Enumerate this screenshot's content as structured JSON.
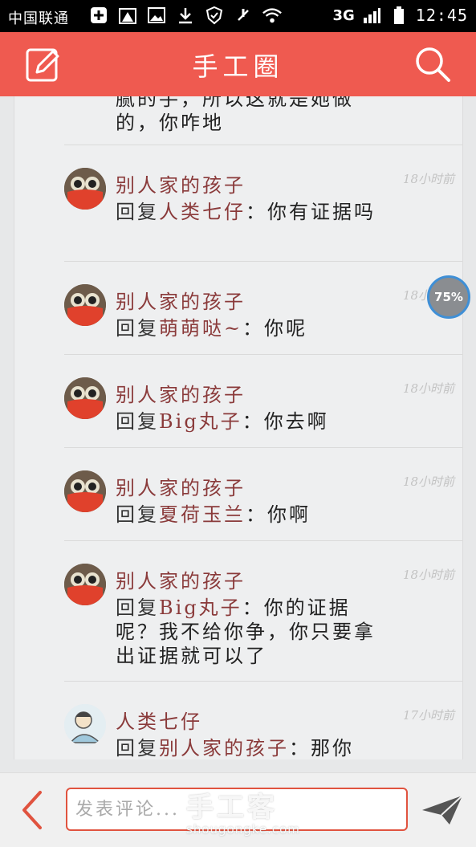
{
  "status_bar": {
    "carrier": "中国联通",
    "network": "3G",
    "time": "12:45",
    "icons": [
      "plus-icon",
      "warning-icon",
      "image-icon",
      "download-icon",
      "shield-icon",
      "mute-icon",
      "wifi-icon",
      "signal-icon",
      "battery-icon"
    ]
  },
  "header": {
    "title": "手工圈",
    "left_icon": "edit-icon",
    "right_icon": "search-icon",
    "background": "#ef5a50"
  },
  "comments": [
    {
      "partial": true,
      "text_line1": "腻的手，所以这就是她做",
      "text_line2": "的，你咋地"
    },
    {
      "author": "别人家的孩子",
      "time": "18小时前",
      "reply_label": "回复",
      "reply_target": "人类七仔",
      "separator": "：",
      "content": "你有证据吗"
    },
    {
      "author": "别人家的孩子",
      "time": "18小时前",
      "reply_label": "回复",
      "reply_target": "萌萌哒~",
      "separator": "：",
      "content": "你呢"
    },
    {
      "author": "别人家的孩子",
      "time": "18小时前",
      "reply_label": "回复",
      "reply_target": "Big丸子",
      "separator": "：",
      "content": "你去啊"
    },
    {
      "author": "别人家的孩子",
      "time": "18小时前",
      "reply_label": "回复",
      "reply_target": "夏荷玉兰",
      "separator": "：",
      "content": "你啊"
    },
    {
      "author": "别人家的孩子",
      "time": "18小时前",
      "reply_label": "回复",
      "reply_target": "Big丸子",
      "separator": "：",
      "content": "你的证据呢？我不给你争，你只要拿出证据就可以了"
    },
    {
      "author": "人类七仔",
      "time": "17小时前",
      "reply_label": "回复",
      "reply_target": "别人家的孩子",
      "separator": "：",
      "content": "那你"
    }
  ],
  "floating_badge": {
    "label": "75%"
  },
  "bottom_bar": {
    "back_icon": "chevron-left-icon",
    "input_placeholder": "发表评论...",
    "send_icon": "send-icon"
  },
  "watermark": {
    "text": "手工客",
    "domain": "shougongke.com"
  }
}
